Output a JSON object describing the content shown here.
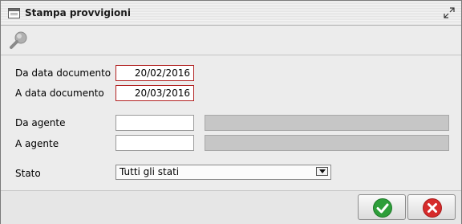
{
  "window": {
    "title": "Stampa provvigioni",
    "title_icon": "window-icon",
    "restore_icon": "restore-icon"
  },
  "toolbar": {
    "search_icon": "magnifier-icon"
  },
  "form": {
    "da_data_documento_label": "Da data documento",
    "da_data_documento_value": "20/02/2016",
    "a_data_documento_label": "A data documento",
    "a_data_documento_value": "20/03/2016",
    "da_agente_label": "Da agente",
    "da_agente_value": "",
    "a_agente_label": "A agente",
    "a_agente_value": "",
    "stato_label": "Stato",
    "stato_value": "Tutti gli stati"
  },
  "footer": {
    "confirm_icon": "check-icon",
    "cancel_icon": "close-icon",
    "confirm_color": "#2e9e3a",
    "cancel_color": "#d62b2b"
  }
}
